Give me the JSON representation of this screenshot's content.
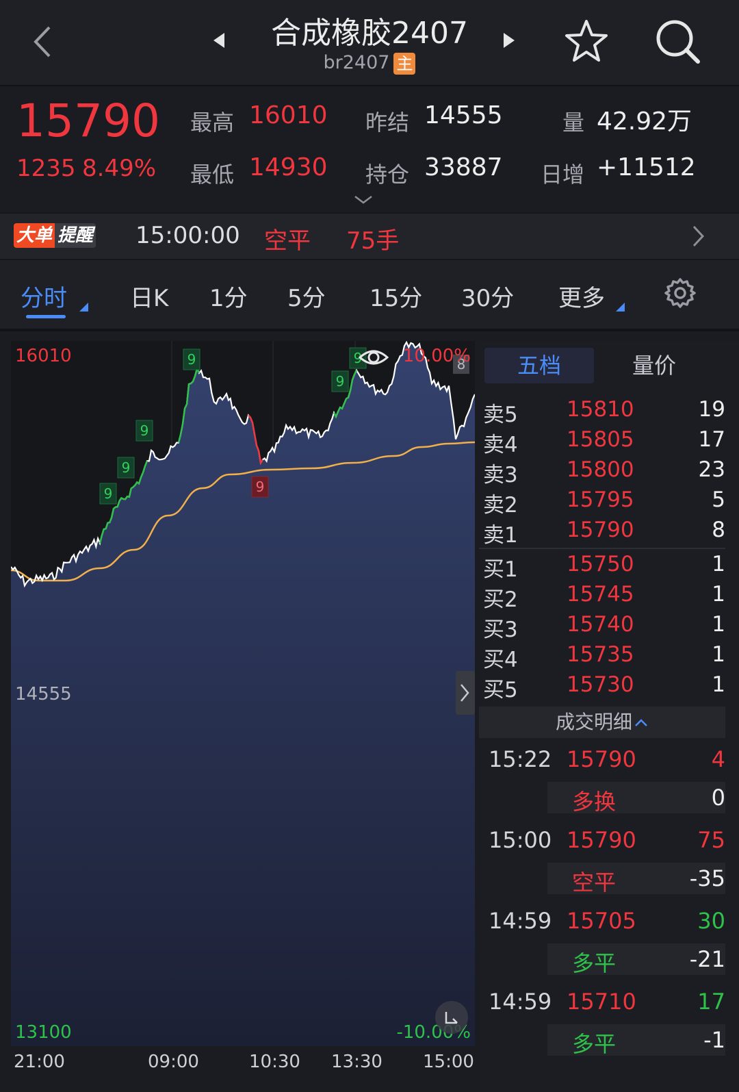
{
  "header": {
    "title": "合成橡胶2407",
    "code": "br2407",
    "main_badge": "主"
  },
  "quote": {
    "last_price": "15790",
    "change": "1235",
    "change_pct": "8.49%",
    "high_label": "最高",
    "high": "16010",
    "low_label": "最低",
    "low": "14930",
    "prev_settle_label": "昨结",
    "prev_settle": "14555",
    "oi_label": "持仓",
    "oi": "33887",
    "volume_label": "量",
    "volume": "42.92万",
    "daily_inc_label": "日增",
    "daily_inc": "+11512"
  },
  "alert": {
    "tag_1": "大单",
    "tag_2": "提醒",
    "time": "15:00:00",
    "action": "空平",
    "lots": "75手"
  },
  "tabs": {
    "items": [
      "分时",
      "日K",
      "1分",
      "5分",
      "15分",
      "30分",
      "更多"
    ],
    "active": "分时"
  },
  "chart": {
    "price_high": "16010",
    "price_mid": "14555",
    "price_low": "13100",
    "pct_high": "10.00%",
    "pct_low": "-10.00%",
    "time_labels": [
      "21:00",
      "09:00",
      "10:30",
      "13:30",
      "15:00"
    ],
    "green_marks": [
      "9",
      "9",
      "9",
      "9",
      "9",
      "9"
    ],
    "red_mark": "9",
    "grey_mark": "8",
    "colors": {
      "price_line": "#ffffff",
      "avg_line": "#f2b04c",
      "area_top": "#33416b",
      "area_bottom": "#1c2034",
      "up": "#2fc24a",
      "down": "#f0363e"
    }
  },
  "book": {
    "tab_active": "五档",
    "tab_other": "量价",
    "asks": [
      {
        "label": "卖5",
        "price": "15810",
        "vol": "19"
      },
      {
        "label": "卖4",
        "price": "15805",
        "vol": "17"
      },
      {
        "label": "卖3",
        "price": "15800",
        "vol": "23"
      },
      {
        "label": "卖2",
        "price": "15795",
        "vol": "5"
      },
      {
        "label": "卖1",
        "price": "15790",
        "vol": "8"
      }
    ],
    "bids": [
      {
        "label": "买1",
        "price": "15750",
        "vol": "1"
      },
      {
        "label": "买2",
        "price": "15745",
        "vol": "1"
      },
      {
        "label": "买3",
        "price": "15740",
        "vol": "1"
      },
      {
        "label": "买4",
        "price": "15735",
        "vol": "1"
      },
      {
        "label": "买5",
        "price": "15730",
        "vol": "1"
      }
    ],
    "trades_title": "成交明细",
    "trades": [
      {
        "time": "15:22",
        "price": "15790",
        "vol": "4",
        "vol_color": "red",
        "kind": "多换",
        "kind_color": "red",
        "delta": "0"
      },
      {
        "time": "15:00",
        "price": "15790",
        "vol": "75",
        "vol_color": "red",
        "kind": "空平",
        "kind_color": "red",
        "delta": "-35"
      },
      {
        "time": "14:59",
        "price": "15705",
        "vol": "30",
        "vol_color": "green",
        "kind": "多平",
        "kind_color": "green",
        "delta": "-21"
      },
      {
        "time": "14:59",
        "price": "15710",
        "vol": "17",
        "vol_color": "green",
        "kind": "多平",
        "kind_color": "green",
        "delta": "-1"
      }
    ]
  }
}
